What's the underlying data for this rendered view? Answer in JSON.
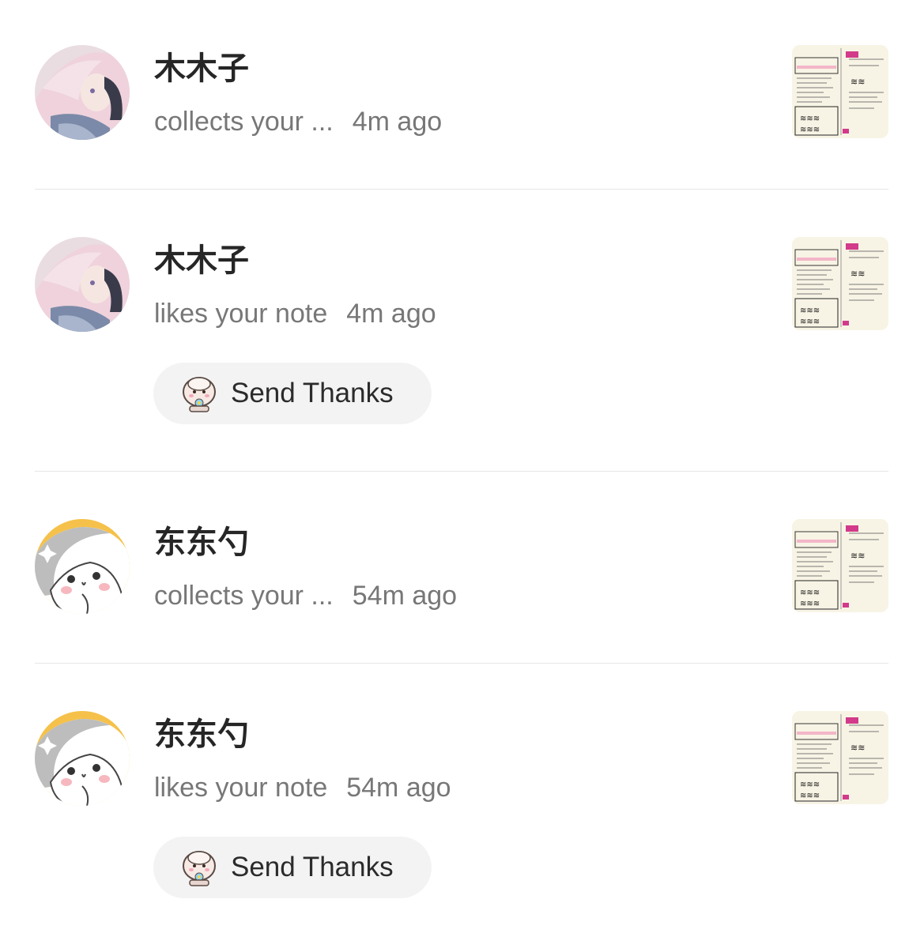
{
  "notifications": [
    {
      "user": "木木子",
      "action": "collects your ...",
      "time": "4m ago",
      "avatar_icon": "anime-girl-avatar",
      "has_thanks": false
    },
    {
      "user": "木木子",
      "action": "likes your note",
      "time": "4m ago",
      "avatar_icon": "anime-girl-avatar",
      "has_thanks": true,
      "thanks_label": "Send Thanks"
    },
    {
      "user": "东东勺",
      "action": "collects your ...",
      "time": "54m ago",
      "avatar_icon": "hamster-avatar",
      "has_thanks": false
    },
    {
      "user": "东东勺",
      "action": "likes your note",
      "time": "54m ago",
      "avatar_icon": "hamster-avatar",
      "has_thanks": true,
      "thanks_label": "Send Thanks"
    }
  ],
  "colors": {
    "divider": "#e6e6e6",
    "secondary_text": "#777777",
    "pill_bg": "#f3f3f3",
    "hamster_bg": "#f5c14a"
  }
}
